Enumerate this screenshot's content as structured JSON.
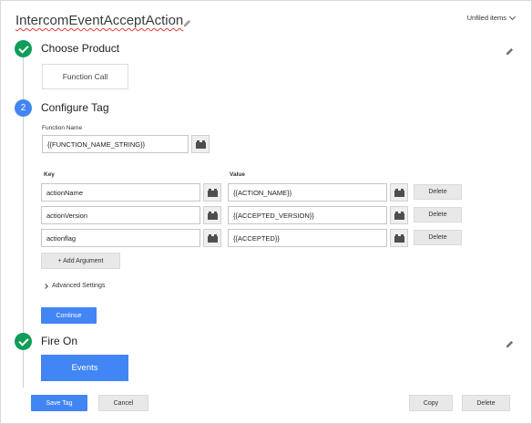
{
  "header": {
    "tag_name": "IntercomEventAcceptAction",
    "folder_label": "Unfiled items"
  },
  "steps": {
    "choose_product": {
      "title": "Choose Product",
      "product_label": "Function Call"
    },
    "configure_tag": {
      "number": "2",
      "title": "Configure Tag",
      "function_name_label": "Function Name",
      "function_name_value": "{{FUNCTION_NAME_STRING}}",
      "key_header": "Key",
      "value_header": "Value",
      "arguments": [
        {
          "key": "actionName",
          "value": "{{ACTION_NAME}}",
          "delete_label": "Delete"
        },
        {
          "key": "actionVersion",
          "value": "{{ACCEPTED_VERSION}}",
          "delete_label": "Delete"
        },
        {
          "key": "actionflag",
          "value": "{{ACCEPTED}}",
          "delete_label": "Delete"
        }
      ],
      "add_argument_label": "+ Add Argument",
      "advanced_settings_label": "Advanced Settings",
      "continue_label": "Continue"
    },
    "fire_on": {
      "title": "Fire On",
      "trigger_label": "Events"
    }
  },
  "footer": {
    "save_label": "Save Tag",
    "cancel_label": "Cancel",
    "copy_label": "Copy",
    "delete_label": "Delete"
  },
  "icons": {
    "check": "check-circle-icon",
    "pencil": "pencil-icon",
    "variable": "variable-brick-icon",
    "chevron_down": "chevron-down-icon",
    "chevron_right": "chevron-right-icon"
  },
  "colors": {
    "primary_blue": "#4285f4",
    "success_green": "#0f9d58",
    "gray_button": "#e8e8e8"
  }
}
